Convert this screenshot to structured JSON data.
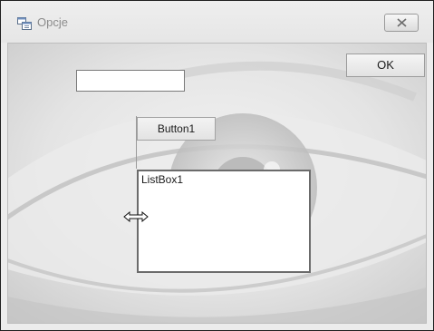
{
  "window": {
    "title": "Opcje",
    "app_icon": "form-window-icon",
    "close_icon": "close-x-icon"
  },
  "form": {
    "textbox_value": "",
    "ok_label": "OK",
    "button1_label": "Button1",
    "listbox_label": "ListBox1",
    "cursor_icon": "horizontal-resize-cursor-icon",
    "background_image": "eye-closeup-photo"
  },
  "colors": {
    "window_frame": "#ececec",
    "border_dark": "#1f1f1f",
    "listbox_border": "#6b6b6b"
  }
}
